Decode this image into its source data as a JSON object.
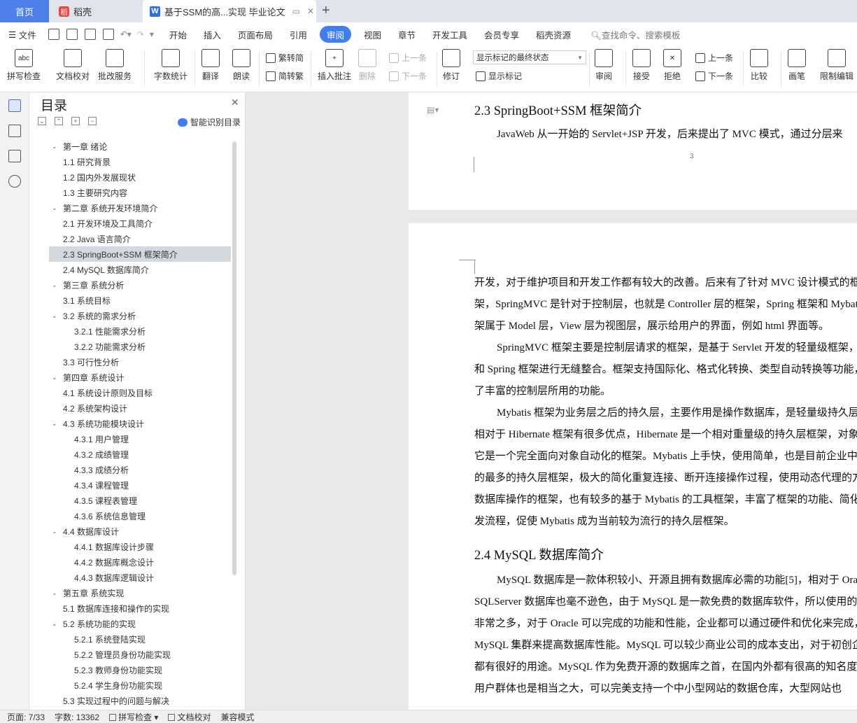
{
  "tabs": {
    "home": "首页",
    "daoke": "稻壳",
    "doc": "基于SSM的高...实现 毕业论文"
  },
  "menu": {
    "file": "文件",
    "items": [
      "开始",
      "插入",
      "页面布局",
      "引用",
      "审阅",
      "视图",
      "章节",
      "开发工具",
      "会员专享",
      "稻壳资源"
    ],
    "active_index": 4,
    "search": "查找命令、搜索模板"
  },
  "ribbon": {
    "spell": "拼写检查",
    "proof": "文档校对",
    "batch": "批改服务",
    "count": "字数统计",
    "translate": "翻译",
    "read": "朗读",
    "to_trad": "繁转简",
    "to_simp": "简转繁",
    "insert_comment": "插入批注",
    "delete": "删除",
    "prev_comment": "上一条",
    "next_comment": "下一条",
    "revise": "修订",
    "markup_state": "显示标记的最终状态",
    "show_markup": "显示标记",
    "review": "审阅",
    "accept": "接受",
    "reject": "拒绝",
    "prev": "上一条",
    "next": "下一条",
    "compare": "比较",
    "pen": "画笔",
    "restrict": "限制编辑"
  },
  "toc": {
    "title": "目录",
    "smart": "智能识别目录",
    "items": [
      {
        "t": "第一章  绪论",
        "lv": 1,
        "open": true
      },
      {
        "t": "1.1  研究背景",
        "lv": 2
      },
      {
        "t": "1.2  国内外发展现状",
        "lv": 2
      },
      {
        "t": "1.3  主要研究内容",
        "lv": 2
      },
      {
        "t": "第二章  系统开发环境简介",
        "lv": 1,
        "open": true
      },
      {
        "t": "2.1  开发环境及工具简介",
        "lv": 2
      },
      {
        "t": "2.2 Java 语言简介",
        "lv": 2
      },
      {
        "t": "2.3 SpringBoot+SSM 框架简介",
        "lv": 2,
        "sel": true
      },
      {
        "t": "2.4 MySQL 数据库简介",
        "lv": 2
      },
      {
        "t": "第三章  系统分析",
        "lv": 1,
        "open": true
      },
      {
        "t": "3.1  系统目标",
        "lv": 2
      },
      {
        "t": "3.2  系统的需求分析",
        "lv": 2,
        "open": true
      },
      {
        "t": "3.2.1  性能需求分析",
        "lv": 3
      },
      {
        "t": "3.2.2  功能需求分析",
        "lv": 3
      },
      {
        "t": "3.3  可行性分析",
        "lv": 2
      },
      {
        "t": "第四章  系统设计",
        "lv": 1,
        "open": true
      },
      {
        "t": "4.1  系统设计原则及目标",
        "lv": 2
      },
      {
        "t": "4.2  系统架构设计",
        "lv": 2
      },
      {
        "t": "4.3  系统功能模块设计",
        "lv": 2,
        "open": true
      },
      {
        "t": "4.3.1  用户管理",
        "lv": 3
      },
      {
        "t": "4.3.2  成绩管理",
        "lv": 3
      },
      {
        "t": "4.3.3  成绩分析",
        "lv": 3
      },
      {
        "t": "4.3.4  课程管理",
        "lv": 3
      },
      {
        "t": "4.3.5  课程表管理",
        "lv": 3
      },
      {
        "t": "4.3.6  系统信息管理",
        "lv": 3
      },
      {
        "t": "4.4  数据库设计",
        "lv": 2,
        "open": true
      },
      {
        "t": "4.4.1  数据库设计步骤",
        "lv": 3
      },
      {
        "t": "4.4.2  数据库概念设计",
        "lv": 3
      },
      {
        "t": "4.4.3  数据库逻辑设计",
        "lv": 3
      },
      {
        "t": "第五章  系统实现",
        "lv": 1,
        "open": true
      },
      {
        "t": "5.1  数据库连接和操作的实现",
        "lv": 2
      },
      {
        "t": "5.2  系统功能的实现",
        "lv": 2,
        "open": true
      },
      {
        "t": "5.2.1  系统登陆实现",
        "lv": 3
      },
      {
        "t": "5.2.2  管理员身份功能实现",
        "lv": 3
      },
      {
        "t": "5.2.3  教师身份功能实现",
        "lv": 3
      },
      {
        "t": "5.2.4  学生身份功能实现",
        "lv": 3
      },
      {
        "t": "5.3  实现过程中的问题与解决",
        "lv": 2
      }
    ]
  },
  "doc": {
    "page1": {
      "heading": "2.3 SpringBoot+SSM 框架简介",
      "line": "JavaWeb 从一开始的 Servlet+JSP 开发，后来提出了 MVC 模式，通过分层来",
      "page_number": "3"
    },
    "page2": {
      "lines": [
        {
          "t": "开发，对于维护项目和开发工作都有较大的改善。后来有了针对 MVC 设计模式的框",
          "i": false
        },
        {
          "t": "架，SpringMVC 是针对于控制层，也就是 Controller 层的框架，Spring 框架和 Mybatis 框",
          "i": false
        },
        {
          "t": "架属于 Model 层，View 层为视图层，展示给用户的界面，例如 html 界面等。",
          "i": false
        },
        {
          "t": "SpringMVC 框架主要是控制层请求的框架，是基于 Servlet 开发的轻量级框架，可以",
          "i": true
        },
        {
          "t": "和 Spring 框架进行无缝整合。框架支持国际化、格式化转换、类型自动转换等功能，提供",
          "i": false
        },
        {
          "t": "了丰富的控制层所用的功能。",
          "i": false
        },
        {
          "t": "Mybatis 框架为业务层之后的持久层，主要作用是操作数据库，是轻量级持久层框架。",
          "i": true
        },
        {
          "t": "相对于 Hibernate 框架有很多优点，Hibernate 是一个相对重量级的持久层框架，对象关系",
          "i": false
        },
        {
          "t": "它是一个完全面向对象自动化的框架。Mybatis 上手快，使用简单，也是目前企业中使用",
          "i": false
        },
        {
          "t": "的最多的持久层框架，极大的简化重复连接、断开连接操作过程，使用动态代理的方式完成",
          "i": false
        },
        {
          "t": "数据库操作的框架，也有较多的基于 Mybatis 的工具框架，丰富了框架的功能、简化了开",
          "i": false
        },
        {
          "t": "发流程，促使 Mybatis 成为当前较为流行的持久层框架。",
          "i": false
        }
      ],
      "heading": "2.4 MySQL 数据库简介",
      "lines2": [
        {
          "t": "MySQL 数据库是一款体积较小、开源且拥有数据库必需的功能[5]，相对于 Oracle 和",
          "i": true
        },
        {
          "t": "SQLServer 数据库也毫不逊色，由于 MySQL 是一款免费的数据库软件，所以使用的企业",
          "i": false
        },
        {
          "t": "非常之多，对于 Oracle 可以完成的功能和性能，企业都可以通过硬件和优化来完成，用",
          "i": false
        },
        {
          "t": "MySQL 集群来提高数据库性能。MySQL 可以较少商业公司的成本支出，对于初创企业",
          "i": false
        },
        {
          "t": "都有很好的用途。MySQL 作为免费开源的数据库之首，在国内外都有很高的知名度，",
          "i": false
        },
        {
          "t": "用户群体也是相当之大，可以完美支持一个中小型网站的数据仓库，大型网站也",
          "i": false
        }
      ]
    }
  },
  "status": {
    "page": "页面: 7/33",
    "words": "字数: 13362",
    "spell": "拼写检查",
    "proof": "文档校对",
    "compat": "兼容模式"
  }
}
